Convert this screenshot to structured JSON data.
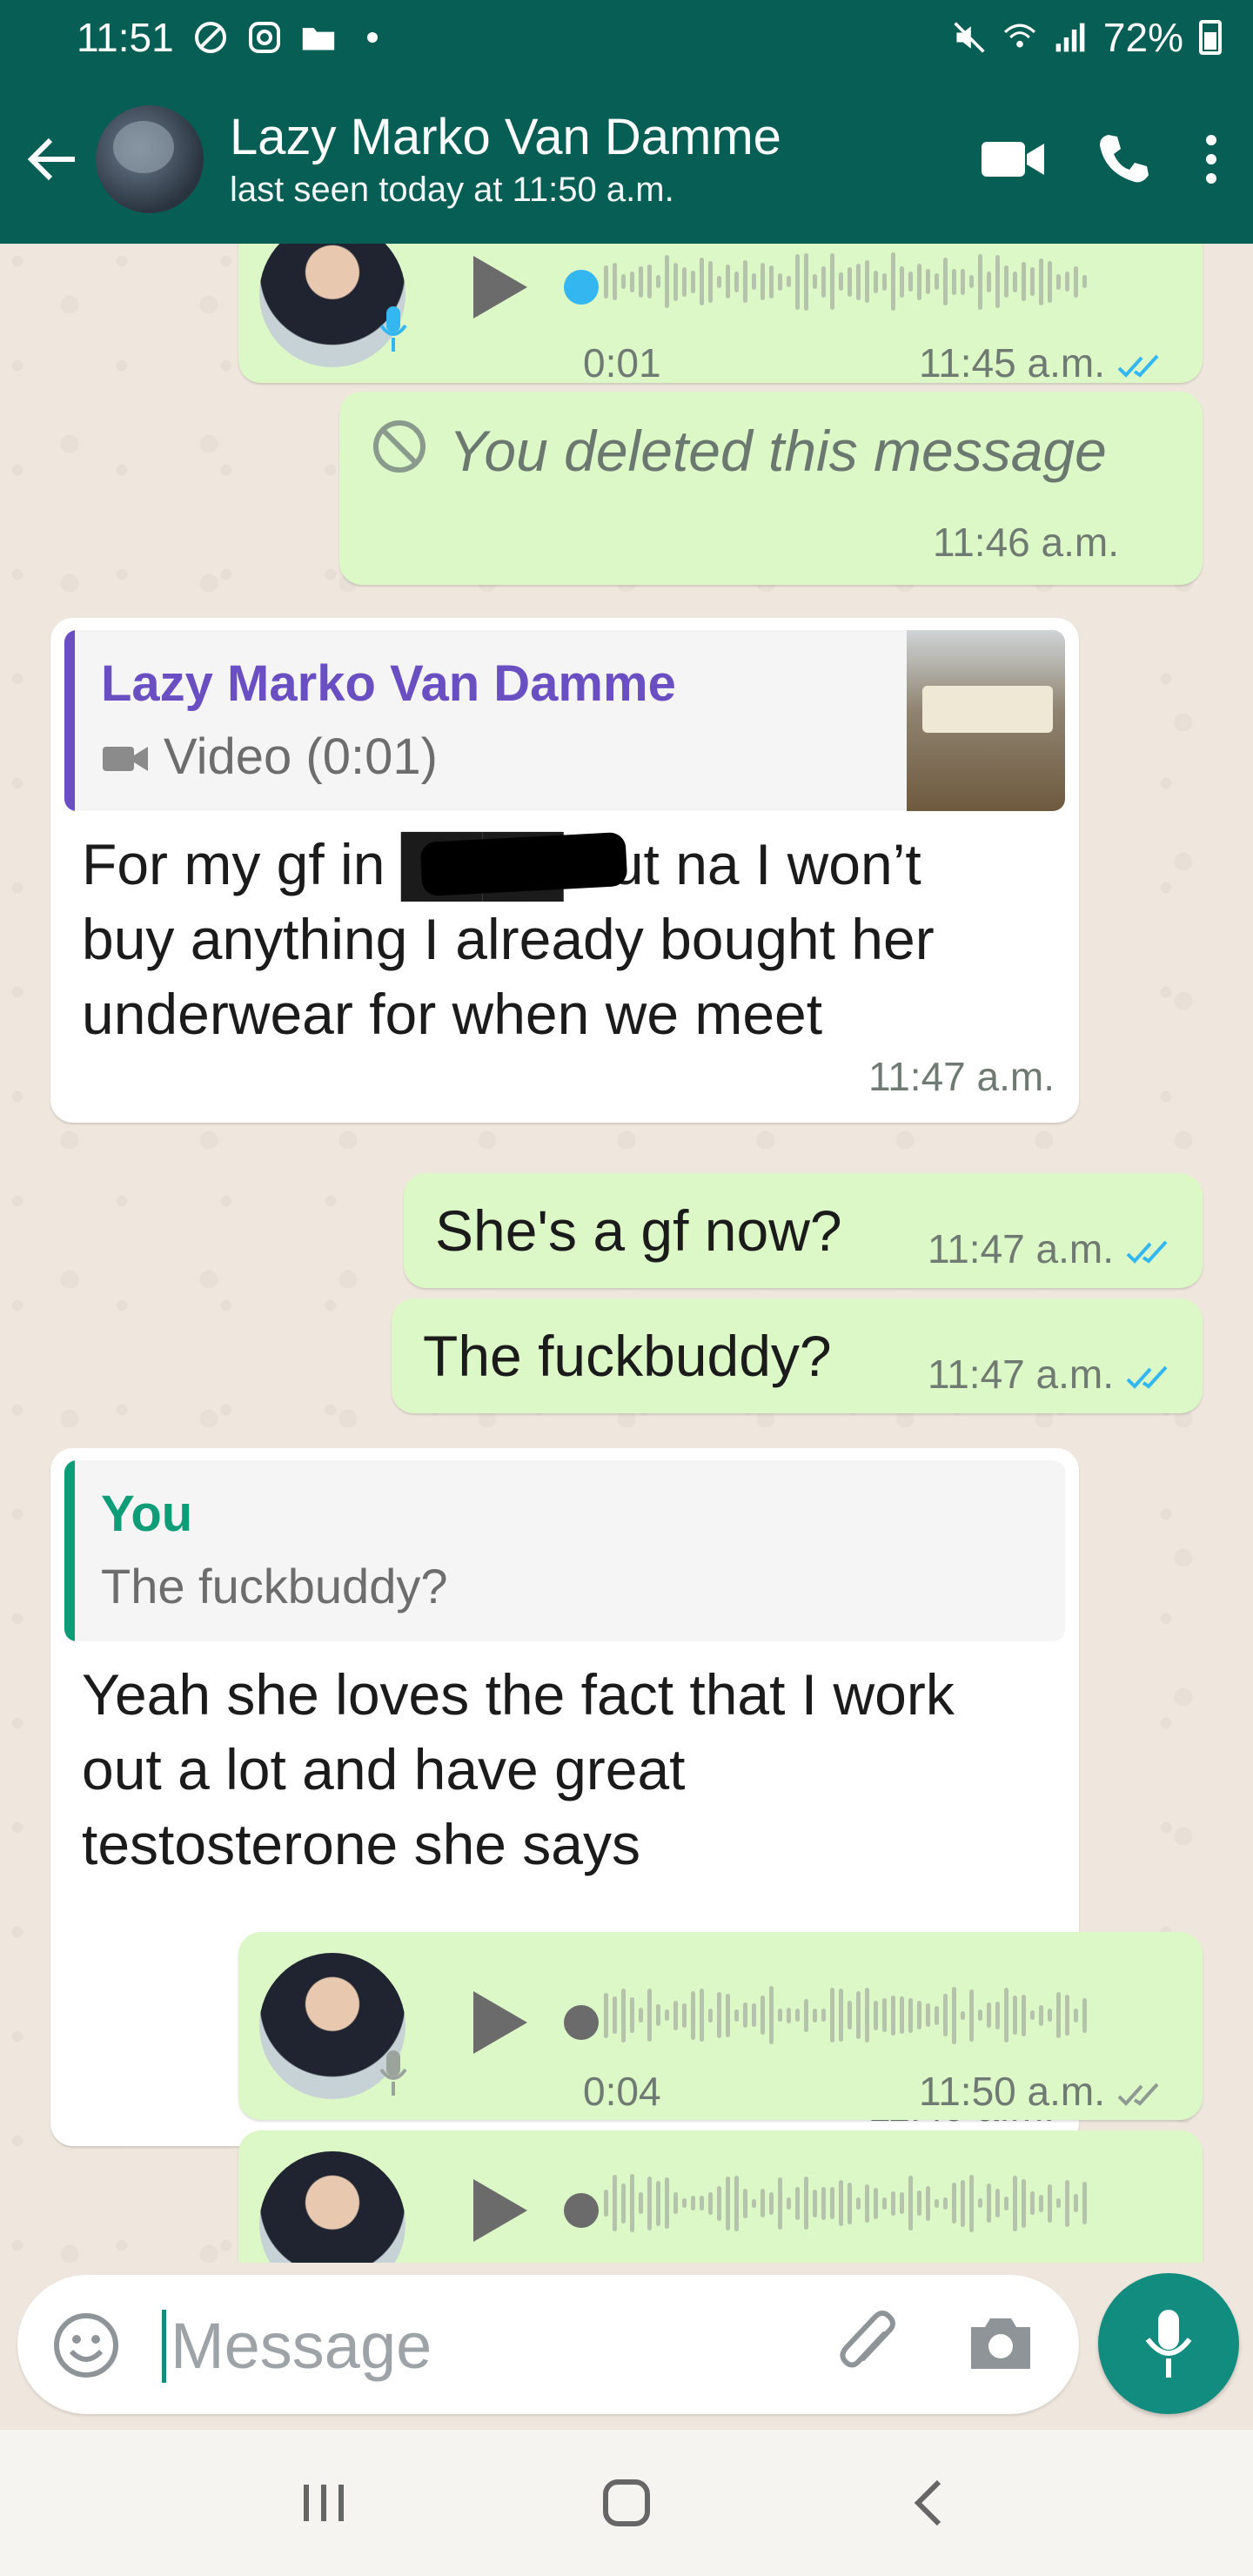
{
  "status_bar": {
    "time": "11:51",
    "battery": "72%"
  },
  "header": {
    "contact_name": "Lazy Marko Van Damme",
    "last_seen": "last seen today at 11:50 a.m.",
    "icons": {
      "back": "arrow-left-icon",
      "video": "video-camera-icon",
      "call": "phone-icon",
      "menu": "more-vertical-icon"
    }
  },
  "messages": [
    {
      "type": "voice",
      "direction": "out",
      "duration": "0:01",
      "time": "11:45 a.m.",
      "status": "read"
    },
    {
      "type": "deleted",
      "direction": "out",
      "text": "You deleted this message",
      "time": "11:46 a.m."
    },
    {
      "type": "text-reply",
      "direction": "in",
      "quote": {
        "author": "Lazy Marko Van Damme",
        "text": "Video (0:01)"
      },
      "text_lines": [
        "For my gf in ████ but na I won’t",
        "buy anything I already bought her",
        "underwear for when we meet"
      ],
      "time": "11:47 a.m."
    },
    {
      "type": "text",
      "direction": "out",
      "text": "She's a gf now?",
      "time": "11:47 a.m.",
      "status": "read"
    },
    {
      "type": "text",
      "direction": "out",
      "text": "The fuckbuddy?",
      "time": "11:47 a.m.",
      "status": "read"
    },
    {
      "type": "text-reply",
      "direction": "in",
      "quote": {
        "author": "You",
        "text": "The fuckbuddy?"
      },
      "text_lines": [
        "Yeah she loves the fact that I work",
        "out a lot and have great",
        "testosterone she says"
      ],
      "time": "11:49 a.m."
    },
    {
      "type": "voice",
      "direction": "out",
      "duration": "0:04",
      "time": "11:50 a.m.",
      "status": "delivered"
    },
    {
      "type": "voice",
      "direction": "out",
      "duration": "",
      "time": "",
      "status": ""
    }
  ],
  "input": {
    "placeholder": "Message"
  },
  "colors": {
    "header": "#075e54",
    "accent": "#128c7e",
    "outgoing": "#dcf8c6",
    "incoming": "#ffffff",
    "read_tick": "#34b7f1"
  }
}
